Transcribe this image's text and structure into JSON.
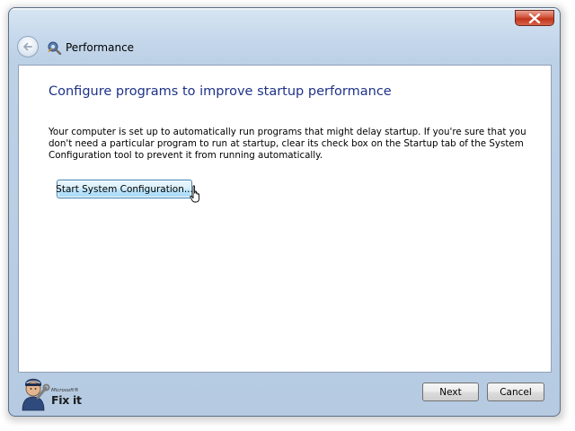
{
  "window": {
    "title": "Performance",
    "close_icon": "close-x-icon"
  },
  "nav": {
    "back_icon": "back-arrow-icon",
    "app_icon": "performance-wrench-icon",
    "title": "Performance"
  },
  "main": {
    "heading": "Configure programs to improve startup performance",
    "description": "Your computer is set up to automatically run programs that might delay startup.  If you're sure that you don't need a particular program to run at startup, clear its check box on the Startup tab of the System Configuration tool to prevent it from running automatically.",
    "start_button_label": "Start System Configuration..."
  },
  "footer": {
    "brand_small": "Microsoft®",
    "brand_name": "Fix it",
    "next_label": "Next",
    "cancel_label": "Cancel"
  },
  "colors": {
    "heading": "#1e3287",
    "close_button": "#c2351b",
    "frame": "#bcd0e6",
    "button_hover": "#bee6fd"
  }
}
